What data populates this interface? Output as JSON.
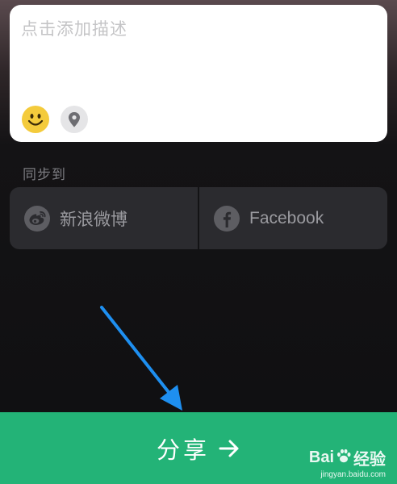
{
  "description": {
    "placeholder": "点击添加描述"
  },
  "toolbar": {
    "emoji_icon": "smiley-icon",
    "location_icon": "location-pin-icon"
  },
  "sync": {
    "label": "同步到",
    "options": [
      {
        "label": "新浪微博",
        "icon": "weibo-icon"
      },
      {
        "label": "Facebook",
        "icon": "facebook-icon"
      }
    ]
  },
  "share_button": {
    "label": "分享",
    "icon": "arrow-right-icon"
  },
  "watermark": {
    "brand": "Bai",
    "brand_suffix": "经验",
    "url": "jingyan.baidu.com"
  },
  "colors": {
    "accent_green": "#23b377",
    "annotation_blue": "#1e8ff0",
    "emoji_yellow": "#f4cb3c"
  }
}
